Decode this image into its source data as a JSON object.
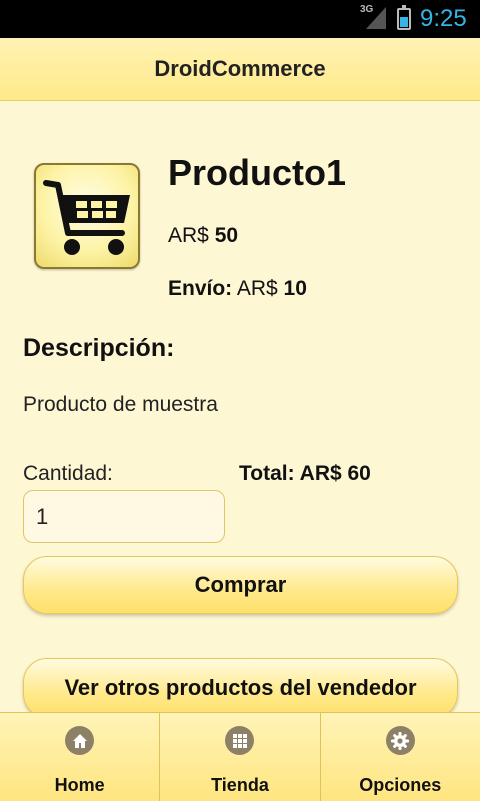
{
  "status_bar": {
    "network": "3G",
    "time": "9:25"
  },
  "action_bar": {
    "title": "DroidCommerce"
  },
  "product": {
    "image_icon": "shopping-cart-icon",
    "name": "Producto1",
    "price_prefix": "AR$ ",
    "price_value": "50",
    "shipping_label": "Envío:",
    "shipping_prefix": " AR$ ",
    "shipping_value": "10",
    "description_heading": "Descripción:",
    "description": "Producto de muestra"
  },
  "purchase": {
    "quantity_label": "Cantidad:",
    "quantity_value": "1",
    "total_text": "Total: AR$ 60",
    "buy_button": "Comprar",
    "seller_button": "Ver otros productos del vendedor"
  },
  "bottom_nav": {
    "items": [
      {
        "label": "Home",
        "icon": "home-icon"
      },
      {
        "label": "Tienda",
        "icon": "grid-icon"
      },
      {
        "label": "Opciones",
        "icon": "gear-icon"
      }
    ]
  },
  "colors": {
    "background": "#fef7d4",
    "bar_yellow": "#ffe98a",
    "status_blue": "#33b5e5"
  }
}
